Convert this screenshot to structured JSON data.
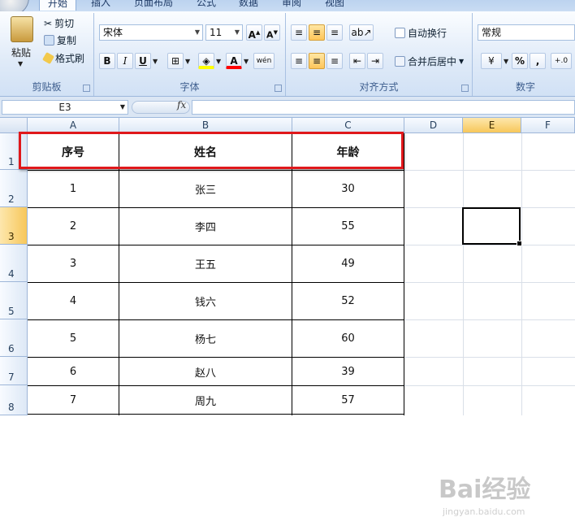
{
  "ribbon": {
    "tabs": [
      "开始",
      "插入",
      "页面布局",
      "公式",
      "数据",
      "审阅",
      "视图"
    ],
    "clipboard": {
      "paste": "粘贴",
      "cut": "剪切",
      "copy": "复制",
      "format_painter": "格式刷",
      "label": "剪贴板"
    },
    "font": {
      "font_name": "宋体",
      "font_size": "11",
      "bold": "B",
      "italic": "I",
      "underline": "U",
      "fill_color": "#ffff00",
      "font_color": "#ff0000",
      "label": "字体"
    },
    "alignment": {
      "wrap": "自动换行",
      "merge": "合并后居中",
      "label": "对齐方式"
    },
    "number": {
      "format": "常规",
      "percent": "%",
      "comma": ",",
      "label": "数字"
    }
  },
  "formula_bar": {
    "name_box": "E3",
    "fx": "fx",
    "formula": ""
  },
  "sheet": {
    "columns": [
      "A",
      "B",
      "C",
      "D",
      "E",
      "F"
    ],
    "selected_column": "E",
    "rows": [
      "1",
      "2",
      "3",
      "4",
      "5",
      "6",
      "7",
      "8"
    ],
    "selected_row": "3",
    "table_header": [
      "序号",
      "姓名",
      "年龄"
    ],
    "table_rows": [
      [
        "1",
        "张三",
        "30"
      ],
      [
        "2",
        "李四",
        "55"
      ],
      [
        "3",
        "王五",
        "49"
      ],
      [
        "4",
        "钱六",
        "52"
      ],
      [
        "5",
        "杨七",
        "60"
      ],
      [
        "6",
        "赵八",
        "39"
      ],
      [
        "7",
        "周九",
        "57"
      ]
    ],
    "active_cell": "E3"
  },
  "watermark": {
    "brand": "Bai经验",
    "url": "jingyan.baidu.com"
  },
  "colors": {
    "highlight": "#e0181b",
    "ribbon": "#dfeaf8"
  }
}
